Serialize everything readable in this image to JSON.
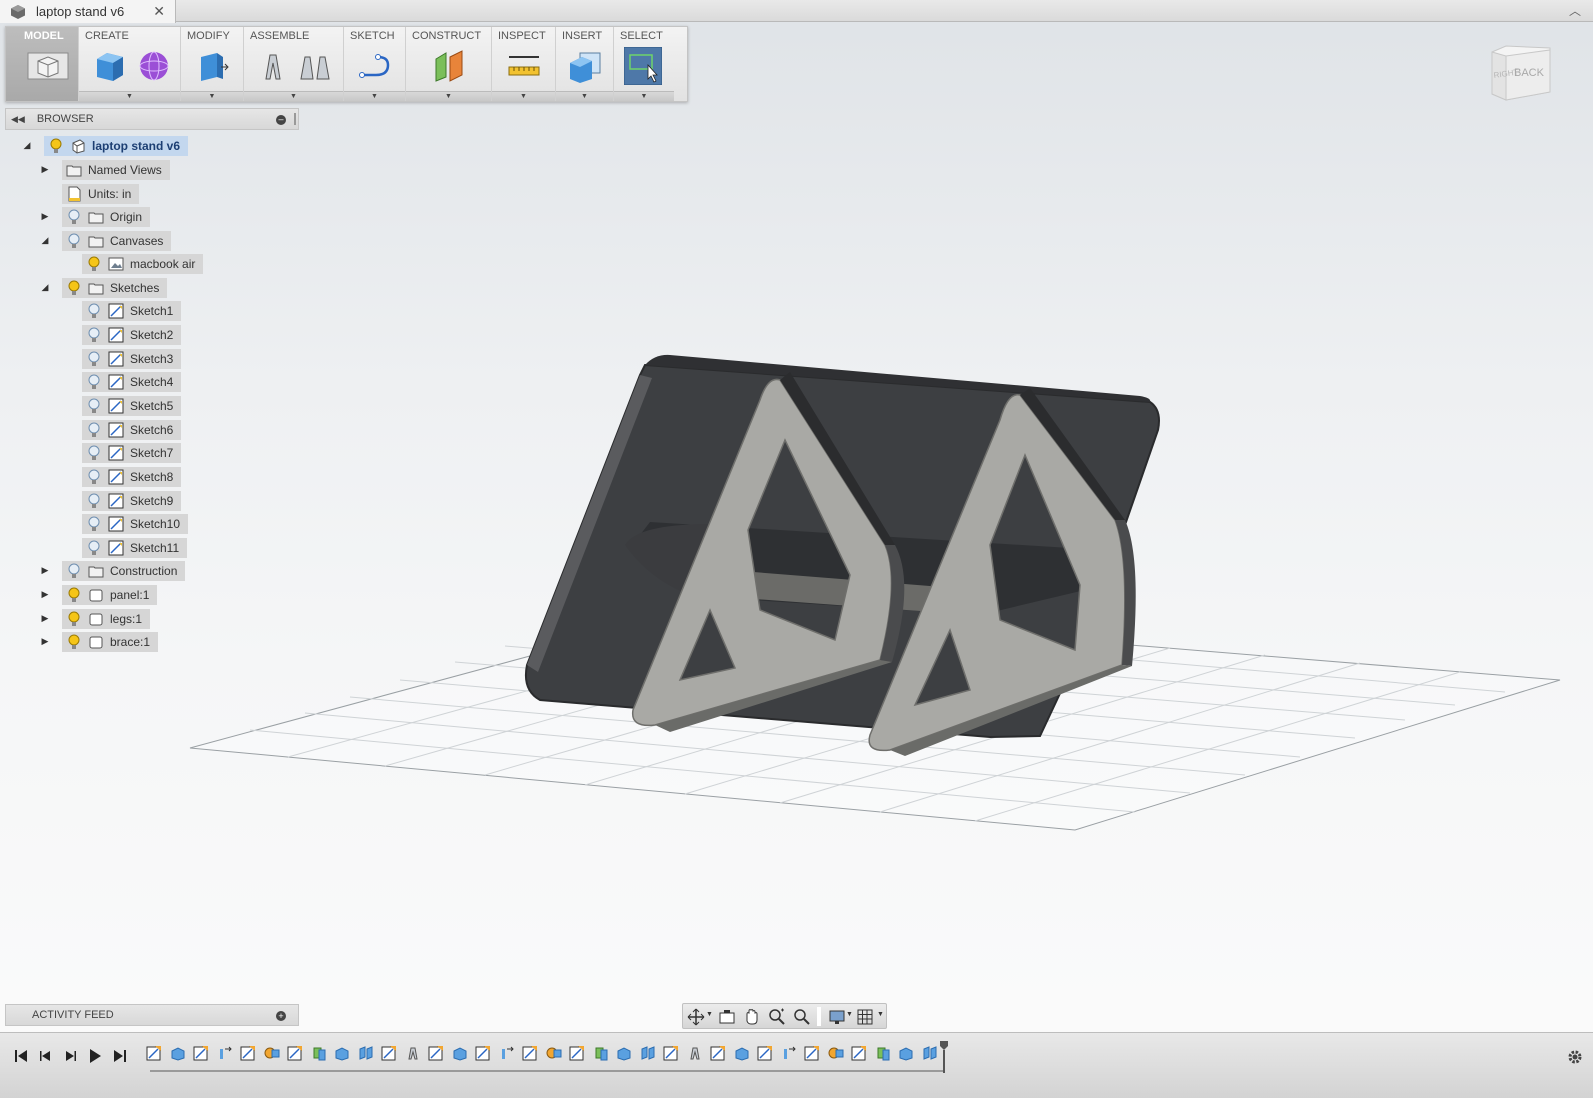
{
  "document_tab": {
    "title": "laptop stand v6",
    "close": "✕"
  },
  "toolbar": {
    "groups": [
      {
        "id": "model",
        "label": "MODEL"
      },
      {
        "id": "create",
        "label": "CREATE"
      },
      {
        "id": "modify",
        "label": "MODIFY"
      },
      {
        "id": "assemble",
        "label": "ASSEMBLE"
      },
      {
        "id": "sketch",
        "label": "SKETCH"
      },
      {
        "id": "construct",
        "label": "CONSTRUCT"
      },
      {
        "id": "inspect",
        "label": "INSPECT"
      },
      {
        "id": "insert",
        "label": "INSERT"
      },
      {
        "id": "select",
        "label": "SELECT"
      }
    ],
    "dropdown_arrow": "▼"
  },
  "browser": {
    "title": "BROWSER",
    "rewind": "◀◀",
    "minus": "–",
    "root": {
      "label": "laptop stand v6"
    },
    "items": [
      {
        "label": "Named Views",
        "toggle": "▶",
        "icon": "folder-icon"
      },
      {
        "label": "Units: in",
        "toggle": "",
        "icon": "document-units-icon"
      },
      {
        "label": "Origin",
        "toggle": "▶",
        "icon": "folder-icon"
      },
      {
        "label": "Canvases",
        "toggle": "◢",
        "icon": "folder-icon"
      },
      {
        "label": "macbook air",
        "toggle": "",
        "icon": "image-icon"
      },
      {
        "label": "Sketches",
        "toggle": "◢",
        "icon": "folder-icon"
      },
      {
        "label": "Sketch1"
      },
      {
        "label": "Sketch2"
      },
      {
        "label": "Sketch3"
      },
      {
        "label": "Sketch4"
      },
      {
        "label": "Sketch5"
      },
      {
        "label": "Sketch6"
      },
      {
        "label": "Sketch7"
      },
      {
        "label": "Sketch8"
      },
      {
        "label": "Sketch9"
      },
      {
        "label": "Sketch10"
      },
      {
        "label": "Sketch11"
      },
      {
        "label": "Construction",
        "toggle": "▶",
        "icon": "folder-icon"
      },
      {
        "label": "panel:1",
        "toggle": "▶",
        "icon": "component-icon"
      },
      {
        "label": "legs:1",
        "toggle": "▶",
        "icon": "component-icon"
      },
      {
        "label": "brace:1",
        "toggle": "▶",
        "icon": "component-icon"
      }
    ]
  },
  "activity_feed": {
    "title": "ACTIVITY FEED",
    "plus": "+"
  },
  "viewcube": {
    "right": "RIGHT",
    "back": "BACK"
  },
  "timeline": {
    "feature_count": 34
  },
  "colors": {
    "selection": "#c3d7ee",
    "select_tool": "#4e78a8",
    "model_dark": "#3d3f42",
    "model_light": "#a9a9a5",
    "bulb_on": "#f5c518"
  }
}
